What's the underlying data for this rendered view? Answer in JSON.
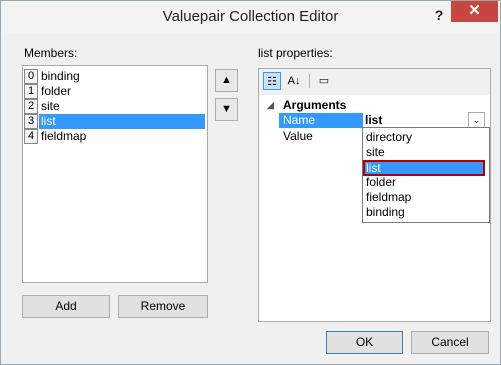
{
  "window": {
    "title": "Valuepair Collection Editor",
    "help": "?",
    "close": "✕"
  },
  "members": {
    "label": "Members:",
    "items": [
      {
        "index": "0",
        "name": "binding",
        "selected": false
      },
      {
        "index": "1",
        "name": "folder",
        "selected": false
      },
      {
        "index": "2",
        "name": "site",
        "selected": false
      },
      {
        "index": "3",
        "name": "list",
        "selected": true
      },
      {
        "index": "4",
        "name": "fieldmap",
        "selected": false
      }
    ]
  },
  "order": {
    "up": "▲",
    "down": "▼"
  },
  "buttons": {
    "add": "Add",
    "remove": "Remove",
    "ok": "OK",
    "cancel": "Cancel"
  },
  "properties": {
    "label": "list properties:",
    "toolbar": {
      "categorized": "☷",
      "alphabetical": "A↓",
      "pages": "▭"
    },
    "category": {
      "toggle": "◢",
      "label": "Arguments"
    },
    "rows": [
      {
        "name": "Name",
        "value": "list",
        "selected": true
      },
      {
        "name": "Value",
        "value": "",
        "selected": false
      }
    ],
    "dropdown_arrow": "⌄",
    "dropdown_options": [
      "directory",
      "site",
      "list",
      "folder",
      "fieldmap",
      "binding"
    ],
    "dropdown_selected": "list"
  }
}
